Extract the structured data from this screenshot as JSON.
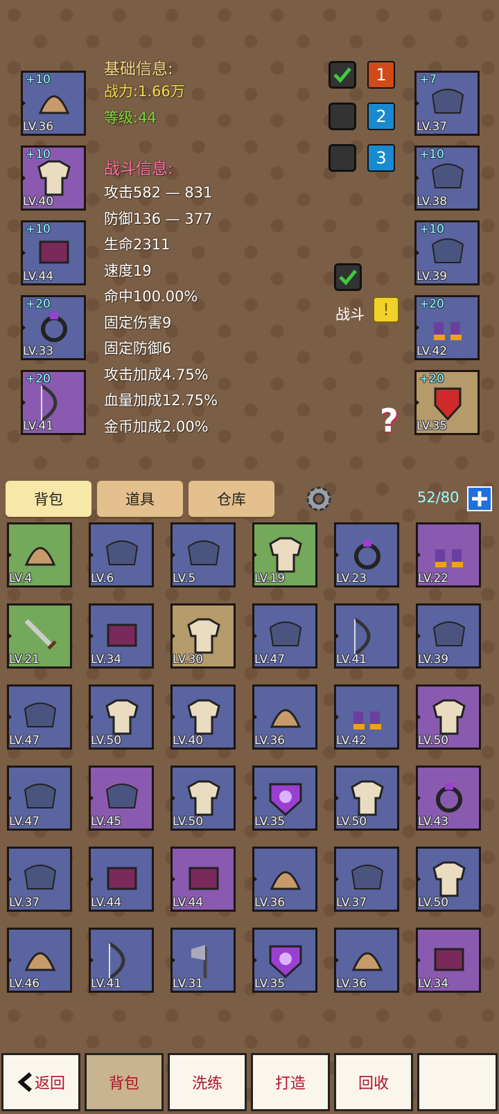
{
  "equip_left": [
    {
      "plus": "+10",
      "level": "LV.36",
      "icon": "antler-helmet-icon",
      "rarity": "blue"
    },
    {
      "plus": "+10",
      "level": "LV.40",
      "icon": "gold-armor-icon",
      "rarity": "purple"
    },
    {
      "plus": "+10",
      "level": "LV.44",
      "icon": "skirt-icon",
      "rarity": "blue"
    },
    {
      "plus": "+20",
      "level": "LV.33",
      "icon": "ring-icon",
      "rarity": "blue"
    },
    {
      "plus": "+20",
      "level": "LV.41",
      "icon": "bow-icon",
      "rarity": "purple"
    }
  ],
  "equip_right": [
    {
      "plus": "+7",
      "level": "LV.37",
      "icon": "glove-icon",
      "rarity": "blue"
    },
    {
      "plus": "+10",
      "level": "LV.38",
      "icon": "zombie-mask-icon",
      "rarity": "blue"
    },
    {
      "plus": "+10",
      "level": "LV.39",
      "icon": "backpack-icon",
      "rarity": "blue"
    },
    {
      "plus": "+20",
      "level": "LV.42",
      "icon": "boots-icon",
      "rarity": "blue"
    },
    {
      "plus": "+20",
      "level": "LV.35",
      "icon": "winged-shield-icon",
      "rarity": "gold"
    }
  ],
  "basic_info": {
    "title": "基础信息:",
    "power": "战力:1.66万",
    "level": "等级:44"
  },
  "battle_info": {
    "title": "战斗信息:",
    "stats": [
      "攻击582 — 831",
      "防御136 — 377",
      "生命2311",
      "速度19",
      "命中100.00%",
      "固定伤害9",
      "固定防御6",
      "攻击加成4.75%",
      "血量加成12.75%",
      "金币加成2.00%"
    ]
  },
  "presets": [
    {
      "num": "1",
      "checked": true,
      "color": "#d04a1a"
    },
    {
      "num": "2",
      "checked": false,
      "color": "#1a8ad0"
    },
    {
      "num": "3",
      "checked": false,
      "color": "#1a8ad0"
    }
  ],
  "battle_toggle": {
    "label": "战斗",
    "checked": true,
    "alert": "!"
  },
  "help": "?",
  "tabs": {
    "bag": "背包",
    "items": "道具",
    "warehouse": "仓库"
  },
  "capacity": "52/80",
  "inventory": [
    {
      "level": "LV.4",
      "rarity": "green",
      "icon": "gold-helmet-icon"
    },
    {
      "level": "LV.6",
      "rarity": "blue",
      "icon": "goggles-icon"
    },
    {
      "level": "LV.5",
      "rarity": "blue",
      "icon": "shirt-icon"
    },
    {
      "level": "LV.19",
      "rarity": "green",
      "icon": "green-armor-icon"
    },
    {
      "level": "LV.23",
      "rarity": "blue",
      "icon": "ring-icon"
    },
    {
      "level": "LV.22",
      "rarity": "purple",
      "icon": "boots-icon"
    },
    {
      "level": "LV.21",
      "rarity": "green",
      "icon": "sword-icon"
    },
    {
      "level": "LV.34",
      "rarity": "blue",
      "icon": "pants-icon"
    },
    {
      "level": "LV.30",
      "rarity": "gold",
      "icon": "robe-icon"
    },
    {
      "level": "LV.47",
      "rarity": "blue",
      "icon": "shirt-icon"
    },
    {
      "level": "LV.41",
      "rarity": "blue",
      "icon": "bow-icon"
    },
    {
      "level": "LV.39",
      "rarity": "blue",
      "icon": "backpack-icon"
    },
    {
      "level": "LV.47",
      "rarity": "blue",
      "icon": "shirt-icon"
    },
    {
      "level": "LV.50",
      "rarity": "blue",
      "icon": "white-armor-icon"
    },
    {
      "level": "LV.40",
      "rarity": "blue",
      "icon": "skull-armor-icon"
    },
    {
      "level": "LV.36",
      "rarity": "blue",
      "icon": "antler-helmet-icon"
    },
    {
      "level": "LV.42",
      "rarity": "blue",
      "icon": "boots-icon"
    },
    {
      "level": "LV.50",
      "rarity": "purple",
      "icon": "jacket-icon"
    },
    {
      "level": "LV.47",
      "rarity": "blue",
      "icon": "shirt-icon"
    },
    {
      "level": "LV.45",
      "rarity": "purple",
      "icon": "bracer-icon"
    },
    {
      "level": "LV.50",
      "rarity": "blue",
      "icon": "white-armor-icon"
    },
    {
      "level": "LV.35",
      "rarity": "blue",
      "icon": "skull-shield-icon"
    },
    {
      "level": "LV.50",
      "rarity": "blue",
      "icon": "white-armor-icon"
    },
    {
      "level": "LV.43",
      "rarity": "purple",
      "icon": "ring-icon"
    },
    {
      "level": "LV.37",
      "rarity": "blue",
      "icon": "shirt-icon"
    },
    {
      "level": "LV.44",
      "rarity": "blue",
      "icon": "skirt-icon"
    },
    {
      "level": "LV.44",
      "rarity": "purple",
      "icon": "white-belt-icon"
    },
    {
      "level": "LV.36",
      "rarity": "blue",
      "icon": "antler-helmet-icon"
    },
    {
      "level": "LV.37",
      "rarity": "blue",
      "icon": "shirt-icon"
    },
    {
      "level": "LV.50",
      "rarity": "blue",
      "icon": "white-armor-icon"
    },
    {
      "level": "LV.46",
      "rarity": "blue",
      "icon": "winged-helmet-icon"
    },
    {
      "level": "LV.41",
      "rarity": "blue",
      "icon": "bow-icon"
    },
    {
      "level": "LV.31",
      "rarity": "blue",
      "icon": "axe-icon"
    },
    {
      "level": "LV.35",
      "rarity": "blue",
      "icon": "skull-shield-icon"
    },
    {
      "level": "LV.36",
      "rarity": "blue",
      "icon": "antler-helmet-icon"
    },
    {
      "level": "LV.34",
      "rarity": "purple",
      "icon": "feather-skirt-icon"
    }
  ],
  "bottom_nav": {
    "back": "返回",
    "bag": "背包",
    "refine": "洗练",
    "forge": "打造",
    "recycle": "回收"
  }
}
